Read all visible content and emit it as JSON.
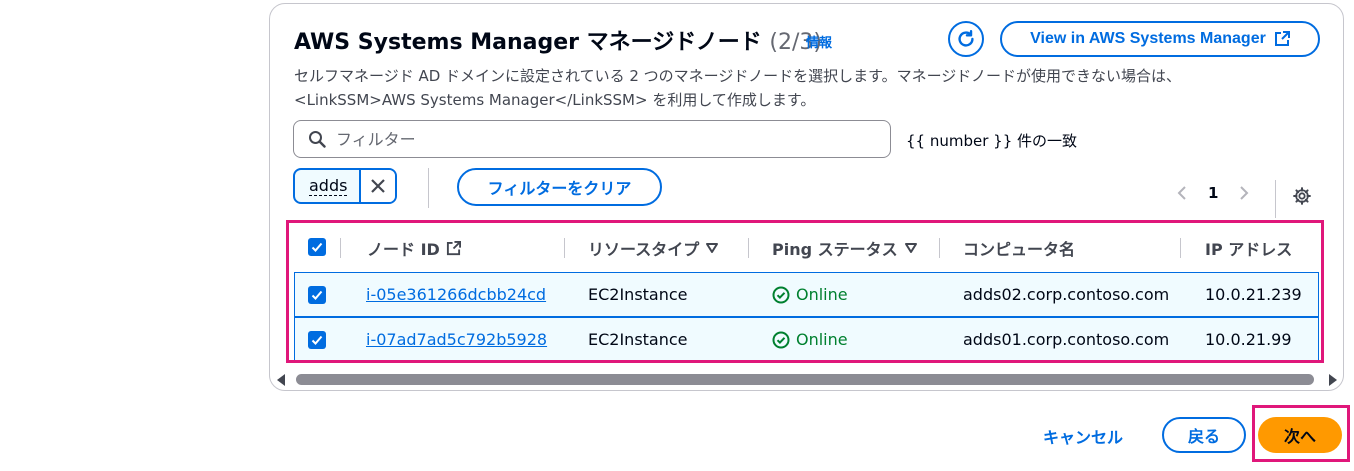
{
  "panel": {
    "title": "AWS Systems Manager マネージドノード",
    "count": "(2/3)",
    "info_link": "情報",
    "view_button": "View in AWS Systems Manager",
    "description_line1": "セルフマネージド AD ドメインに設定されている 2 つのマネージドノードを選択します。マネージドノードが使用できない場合は、",
    "description_line2": "<LinkSSM>AWS Systems Manager</LinkSSM> を利用して作成します。"
  },
  "filter": {
    "placeholder": "フィルター",
    "match_count": "{{ number }} 件の一致",
    "token_value": "adds",
    "clear_button": "フィルターをクリア"
  },
  "pagination": {
    "current_page": "1"
  },
  "table": {
    "columns": [
      "ノード ID",
      "リソースタイプ",
      "Ping ステータス",
      "コンピュータ名",
      "IP アドレス"
    ],
    "rows": [
      {
        "node_id": "i-05e361266dcbb24cd",
        "resource_type": "EC2Instance",
        "ping_status": "Online",
        "computer_name": "adds02.corp.contoso.com",
        "ip_address": "10.0.21.239"
      },
      {
        "node_id": "i-07ad7ad5c792b5928",
        "resource_type": "EC2Instance",
        "ping_status": "Online",
        "computer_name": "adds01.corp.contoso.com",
        "ip_address": "10.0.21.99"
      }
    ]
  },
  "footer": {
    "cancel": "キャンセル",
    "back": "戻る",
    "next": "次へ"
  },
  "colors": {
    "accent": "#006ce0",
    "primary_button": "#ff9900",
    "success": "#00802f",
    "highlight": "#e0177a"
  },
  "icons": [
    "refresh-icon",
    "external-link-icon",
    "search-icon",
    "close-icon",
    "chevron-left-icon",
    "chevron-right-icon",
    "gear-icon",
    "sort-down-icon",
    "status-success-icon",
    "checkbox-checked-icon"
  ]
}
